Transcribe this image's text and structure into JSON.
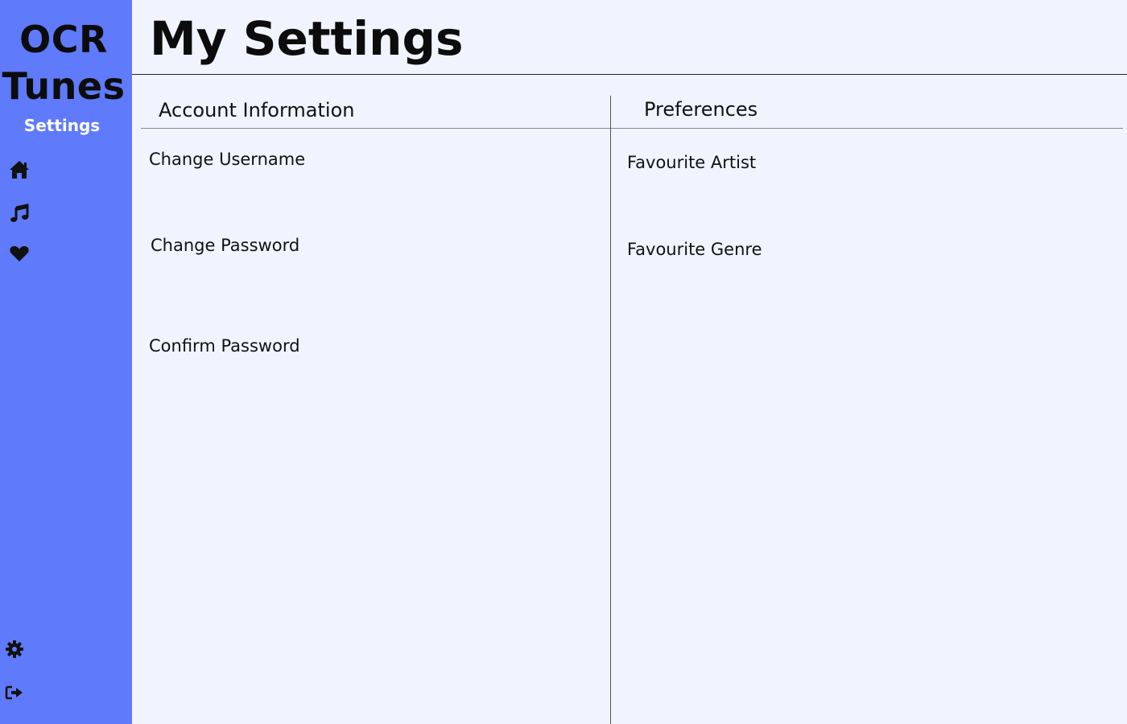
{
  "sidebar": {
    "brand_line1": "OCR",
    "brand_line2": "Tunes",
    "subtitle": "Settings",
    "nav": [
      {
        "icon": "home-icon"
      },
      {
        "icon": "music-note-icon"
      },
      {
        "icon": "heart-icon"
      }
    ],
    "bottom": [
      {
        "icon": "gear-icon"
      },
      {
        "icon": "sign-out-icon"
      }
    ]
  },
  "header": {
    "title": "My Settings"
  },
  "account": {
    "heading": "Account Information",
    "fields": [
      {
        "label": "Change Username"
      },
      {
        "label": "Change Password"
      },
      {
        "label": "Confirm Password"
      }
    ]
  },
  "preferences": {
    "heading": "Preferences",
    "fields": [
      {
        "label": "Favourite Artist"
      },
      {
        "label": "Favourite Genre"
      }
    ]
  },
  "colors": {
    "sidebar": "#5f7afa",
    "background": "#f1f4fe",
    "text": "#111111",
    "subtitle": "#ffffff"
  }
}
